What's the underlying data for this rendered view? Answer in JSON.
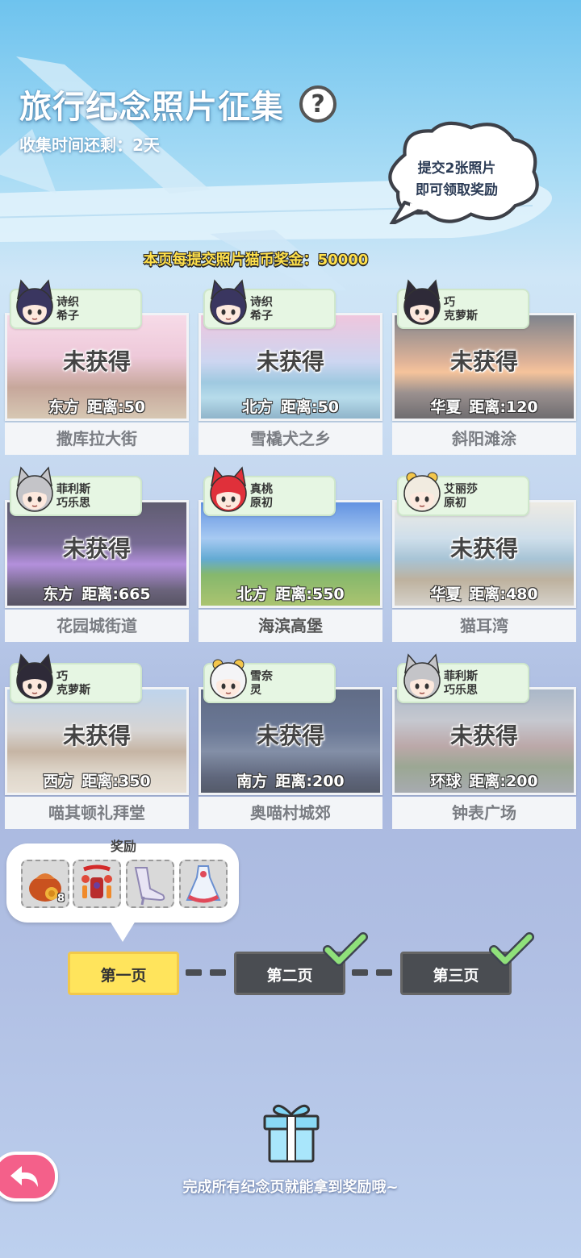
{
  "header": {
    "title": "旅行纪念照片征集",
    "help_symbol": "?",
    "time_left": "收集时间还剩：2天"
  },
  "cloud_tip": {
    "line1": "提交2张照片",
    "line2": "即可领取奖励"
  },
  "bonus": "本页每提交照片猫币奖金：50000",
  "cards": [
    {
      "char_line1": "诗织",
      "char_line2": "希子",
      "status": "未获得",
      "direction": "东方",
      "distance": "距离:50",
      "name": "撒库拉大街"
    },
    {
      "char_line1": "诗织",
      "char_line2": "希子",
      "status": "未获得",
      "direction": "北方",
      "distance": "距离:50",
      "name": "雪橇犬之乡"
    },
    {
      "char_line1": "巧",
      "char_line2": "克萝斯",
      "status": "未获得",
      "direction": "华夏",
      "distance": "距离:120",
      "name": "斜阳滩涂"
    },
    {
      "char_line1": "菲利斯",
      "char_line2": "巧乐思",
      "status": "未获得",
      "direction": "东方",
      "distance": "距离:665",
      "name": "花园城街道"
    },
    {
      "char_line1": "真桃",
      "char_line2": "原初",
      "status": "",
      "direction": "北方",
      "distance": "距离:550",
      "name": "海滨高堡"
    },
    {
      "char_line1": "艾丽莎",
      "char_line2": "原初",
      "status": "未获得",
      "direction": "华夏",
      "distance": "距离:480",
      "name": "猫耳湾"
    },
    {
      "char_line1": "巧",
      "char_line2": "克萝斯",
      "status": "未获得",
      "direction": "西方",
      "distance": "距离:350",
      "name": "喵其顿礼拜堂"
    },
    {
      "char_line1": "雪奈",
      "char_line2": "灵",
      "status": "未获得",
      "direction": "南方",
      "distance": "距离:200",
      "name": "奥喵村城郊"
    },
    {
      "char_line1": "菲利斯",
      "char_line2": "巧乐思",
      "status": "未获得",
      "direction": "环球",
      "distance": "距离:200",
      "name": "钟表广场"
    }
  ],
  "rewards": {
    "label": "奖励",
    "items": [
      {
        "icon": "treasure-bag-icon",
        "count": "8"
      },
      {
        "icon": "ornament-icon",
        "count": ""
      },
      {
        "icon": "high-heel-icon",
        "count": ""
      },
      {
        "icon": "dress-icon",
        "count": ""
      }
    ]
  },
  "pages": [
    {
      "label": "第一页",
      "state": "current"
    },
    {
      "label": "第二页",
      "state": "completed"
    },
    {
      "label": "第三页",
      "state": "completed"
    }
  ],
  "bottom_hint": "完成所有纪念页就能拿到奖励哦~",
  "colors": {
    "current_page": "#ffe45c",
    "other_page": "#4a4d52",
    "check": "#8fe07a",
    "back_button": "#f4608a",
    "tag_bg": "#e6f6e3"
  }
}
